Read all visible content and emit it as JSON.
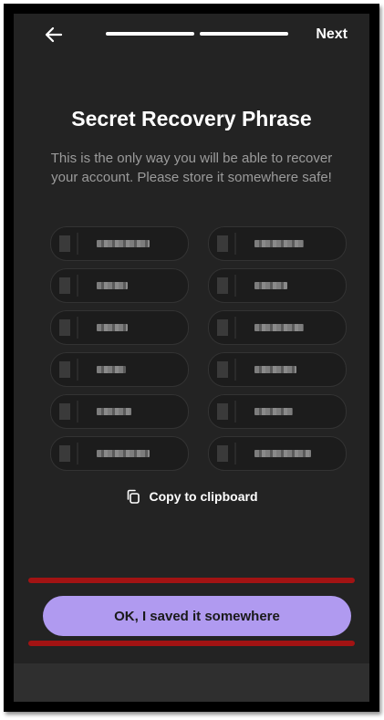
{
  "nav": {
    "next_label": "Next",
    "progress_segments": 2,
    "progress_filled": 2
  },
  "header": {
    "title": "Secret Recovery Phrase",
    "subtitle": "This is the only way you will be able to recover your account. Please store it somewhere safe!"
  },
  "phrase": {
    "words_redacted": true,
    "word_count": 12
  },
  "actions": {
    "copy_label": "Copy to clipboard",
    "confirm_label": "OK, I saved it somewhere"
  },
  "colors": {
    "screen_bg": "#232323",
    "accent": "#b09af0",
    "annotation_red": "#b01212"
  }
}
